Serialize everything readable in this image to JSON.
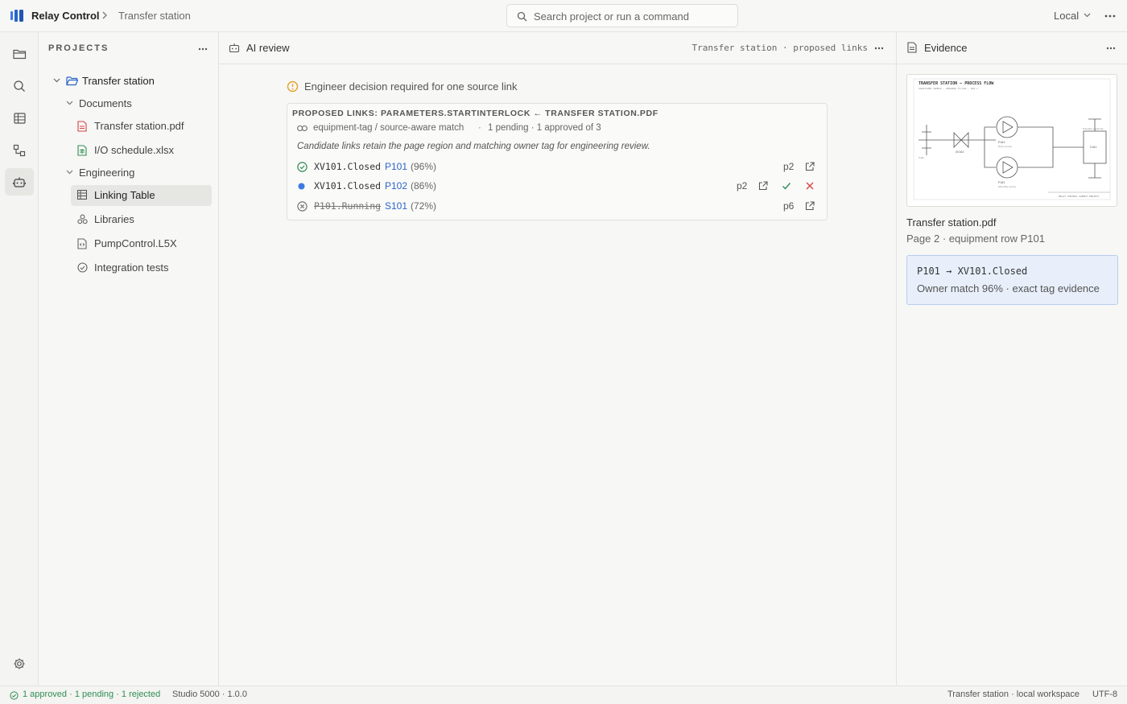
{
  "app": {
    "title": "Relay Control",
    "breadcrumb": "Transfer station"
  },
  "search": {
    "placeholder": "Search project or run a command"
  },
  "environment": {
    "label": "Local"
  },
  "activity_bar": {
    "items": [
      "folder-icon",
      "search-icon",
      "table-icon",
      "flow-icon",
      "robot-icon"
    ],
    "active": "robot-icon",
    "bottom": "gear-icon"
  },
  "sidebar": {
    "heading": "PROJECTS",
    "tree": {
      "project": "Transfer station",
      "documents_label": "Documents",
      "documents": [
        "Transfer station.pdf",
        "I/O schedule.xlsx"
      ],
      "engineering_label": "Engineering",
      "engineering": [
        "Linking Table",
        "Libraries",
        "PumpControl.L5X",
        "Integration tests"
      ],
      "selected": "Linking Table"
    }
  },
  "main": {
    "tab_title": "AI review",
    "context": "Transfer station · proposed links",
    "notice": "Engineer decision required for one source link",
    "card": {
      "title": "PROPOSED LINKS: PARAMETERS.STARTINTERLOCK ← TRANSFER STATION.PDF",
      "match_type": "equipment-tag / source-aware match",
      "separator": "·",
      "status_summary": "1 pending · 1 approved of 3",
      "description": "Candidate links retain the page region and matching owner tag for engineering review.",
      "links": [
        {
          "tag": "XV101.Closed",
          "candidate": "P101",
          "confidence": "(96%)",
          "page": "p2",
          "status": "approved"
        },
        {
          "tag": "XV101.Closed",
          "candidate": "P102",
          "confidence": "(86%)",
          "page": "p2",
          "status": "pending"
        },
        {
          "tag": "P101.Running",
          "candidate": "S101",
          "confidence": "(72%)",
          "page": "p6",
          "status": "rejected"
        }
      ]
    }
  },
  "evidence": {
    "title": "Evidence",
    "thumbnail": {
      "heading": "TRANSFER STATION — PROCESS FLOW",
      "subheading": "SANITIZED SAMPLE · DRAWING TS-PA4 · REV C",
      "labels": {
        "valve": "XV101",
        "pump1": "P101",
        "pump1_sub": "Duty pump",
        "pump2": "P102",
        "pump2_sub": "Standby pump",
        "tank": "S101",
        "tank_label": "Transfer capacity",
        "inlet": "Inlet",
        "footer": "RELAY CONTROL SAMPLE PROJECT"
      }
    },
    "file": "Transfer station.pdf",
    "location": "Page 2 · equipment row P101",
    "match_line": "P101 → XV101.Closed",
    "match_detail": "Owner match 96% · exact tag evidence"
  },
  "statusbar": {
    "counts": "1 approved · 1 pending · 1 rejected",
    "version": "Studio 5000 · 1.0.0",
    "workspace": "Transfer station · local workspace",
    "encoding": "UTF-8"
  },
  "colors": {
    "accent": "#2a66c7",
    "approved": "#2f8f53",
    "pending": "#3b7be3",
    "rejected": "#d64545",
    "warning": "#e5a12b"
  }
}
